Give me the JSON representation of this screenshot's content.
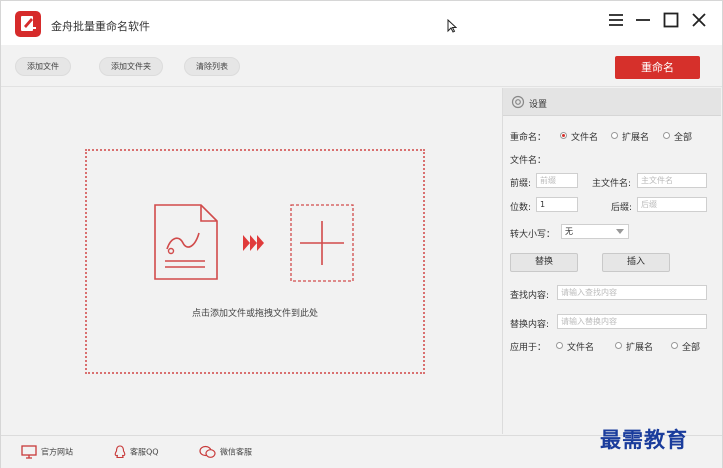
{
  "app": {
    "title": "金舟批量重命名软件"
  },
  "toolbar": {
    "add_file": "添加文件",
    "add_folder": "添加文件夹",
    "clear_list": "清除列表",
    "rename": "重命名"
  },
  "drop_area": {
    "hint": "点击添加文件或拖拽文件到此处"
  },
  "settings": {
    "title": "设置",
    "rename_label": "重命名：",
    "rename_options": [
      "文件名",
      "扩展名",
      "全部"
    ],
    "filename_label": "文件名：",
    "prefix_label": "前缀:",
    "prefix_placeholder": "前缀",
    "main_name_label": "主文件名:",
    "main_name_placeholder": "主文件名",
    "digits_label": "位数:",
    "digits_value": "1",
    "suffix_label": "后缀:",
    "suffix_placeholder": "后缀",
    "case_label": "转大小写：",
    "case_value": "无",
    "replace_button": "替换",
    "insert_button": "插入",
    "find_label": "查找内容:",
    "find_placeholder": "请输入查找内容",
    "replace_label": "替换内容:",
    "replace_placeholder": "请输入替换内容",
    "apply_label": "应用于：",
    "apply_options": [
      "文件名",
      "扩展名",
      "全部"
    ]
  },
  "footer": {
    "website": "官方网站",
    "qq": "客服QQ",
    "wechat": "微信客服"
  },
  "watermark": "最需教育",
  "colors": {
    "accent": "#d6302b",
    "watermark": "#1a3c9c"
  }
}
